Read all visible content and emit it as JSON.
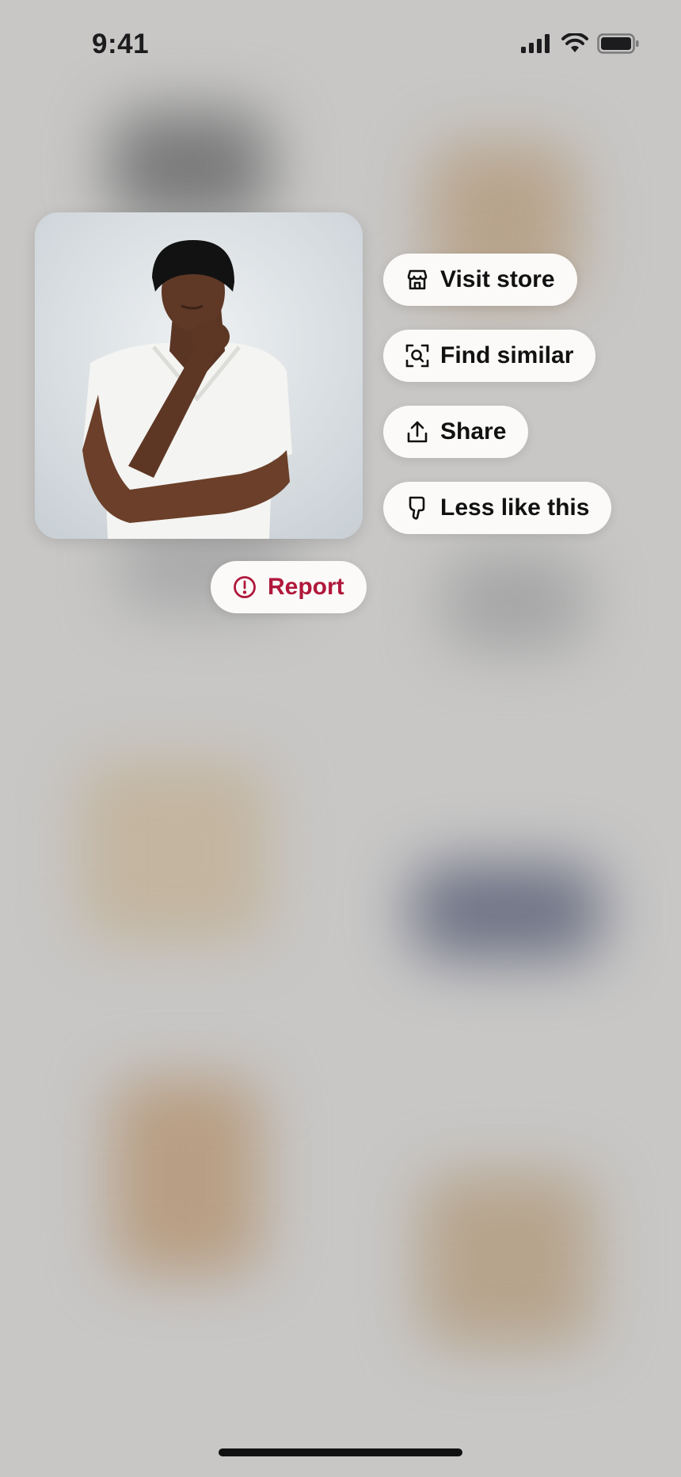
{
  "status_bar": {
    "time": "9:41",
    "icons": [
      "cellular-signal-icon",
      "wifi-icon",
      "battery-icon"
    ]
  },
  "pin": {
    "image": "man-in-black-beanie-white-tee-photo"
  },
  "actions": {
    "visit_store": {
      "label": "Visit store",
      "icon": "storefront-icon"
    },
    "find_similar": {
      "label": "Find similar",
      "icon": "visual-search-icon"
    },
    "share": {
      "label": "Share",
      "icon": "share-icon"
    },
    "less_like_this": {
      "label": "Less like this",
      "icon": "thumbs-down-icon"
    },
    "report": {
      "label": "Report",
      "icon": "alert-circle-icon"
    }
  },
  "colors": {
    "background": "#c8c7c6",
    "pill_background": "#fbfaf8",
    "report_red": "#b0183c",
    "text": "#111111"
  }
}
